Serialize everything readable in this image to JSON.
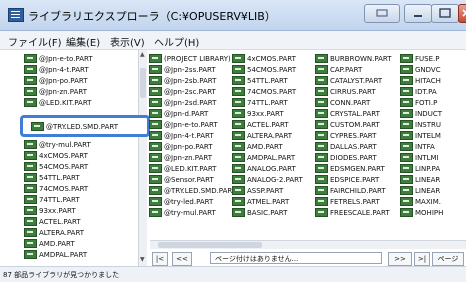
{
  "window": {
    "title": "ライブラリエクスプローラ（C:¥OPUSERV¥LIB）"
  },
  "menu": [
    {
      "label": "ファイル(F)"
    },
    {
      "label": "編集(E)"
    },
    {
      "label": "表示(V)"
    },
    {
      "label": "ヘルプ(H)"
    }
  ],
  "left_tree": {
    "items": [
      "@Jpn-e-to.PART",
      "@Jpn-4-t.PART",
      "@Jpn-po.PART",
      "@Jpn-zn.PART",
      "@LED.KIT.PART",
      "@try-mul.PART",
      "4xCMOS.PART",
      "54CMOS.PART",
      "54TTL.PART",
      "74CMOS.PART",
      "74TTL.PART",
      "93xx.PART",
      "ACTEL.PART",
      "ALTERA.PART",
      "AMD.PART",
      "AMDPAL.PART"
    ],
    "highlighted": "@TRY.LED.SMD.PART"
  },
  "columns": [
    [
      "(PROJECT LIBRARY)",
      "@Jpn-2ss.PART",
      "@Jpn-2sb.PART",
      "@Jpn-2sc.PART",
      "@Jpn-2sd.PART",
      "@Jpn-d.PART",
      "@Jpn-e-to.PART",
      "@Jpn-4-t.PART",
      "@Jpn-po.PART",
      "@Jpn-zn.PART",
      "@LED.KIT.PART",
      "@Sensor.PART",
      "@TRY.LED.SMD.PART",
      "@try-led.PART",
      "@try-mul.PART"
    ],
    [
      "4xCMOS.PART",
      "54CMOS.PART",
      "54TTL.PART",
      "74CMOS.PART",
      "74TTL.PART",
      "93xx.PART",
      "ACTEL.PART",
      "ALTERA.PART",
      "AMD.PART",
      "AMDPAL.PART",
      "ANALOG.PART",
      "ANALOG-2.PART",
      "ASSP.PART",
      "ATMEL.PART",
      "BASIC.PART"
    ],
    [
      "BURBROWN.PART",
      "CAP.PART",
      "CATALYST.PART",
      "CIRRUS.PART",
      "CONN.PART",
      "CRYSTAL.PART",
      "CUSTOM.PART",
      "CYPRES.PART",
      "DALLAS.PART",
      "DIODES.PART",
      "EDSMGEN.PART",
      "EDSPICE.PART",
      "FAIRCHILD.PART",
      "FETRELS.PART",
      "FREESCALE.PART"
    ],
    [
      "FUSE.P",
      "GNDVC",
      "HITACH",
      "IDT.PA",
      "FOTI.P",
      "INDUCT",
      "INSTRU",
      "INTELM",
      "INTFA",
      "INTLMI",
      "LINP.PA",
      "LINEAR",
      "LINEAR",
      "MAXIM.",
      "MOHIPH"
    ]
  ],
  "pager": {
    "first": "|<",
    "prev": "<<",
    "info": "ページ付けはありません...",
    "next": ">>",
    "last": ">|",
    "page_label": "ページ"
  },
  "status": {
    "text": "87 部品ライブラリが見つかりました"
  },
  "colors": {
    "accent": "#3f7ed6",
    "library_icon": "#3f7d3f",
    "titlebar": "#c2d5ee"
  }
}
